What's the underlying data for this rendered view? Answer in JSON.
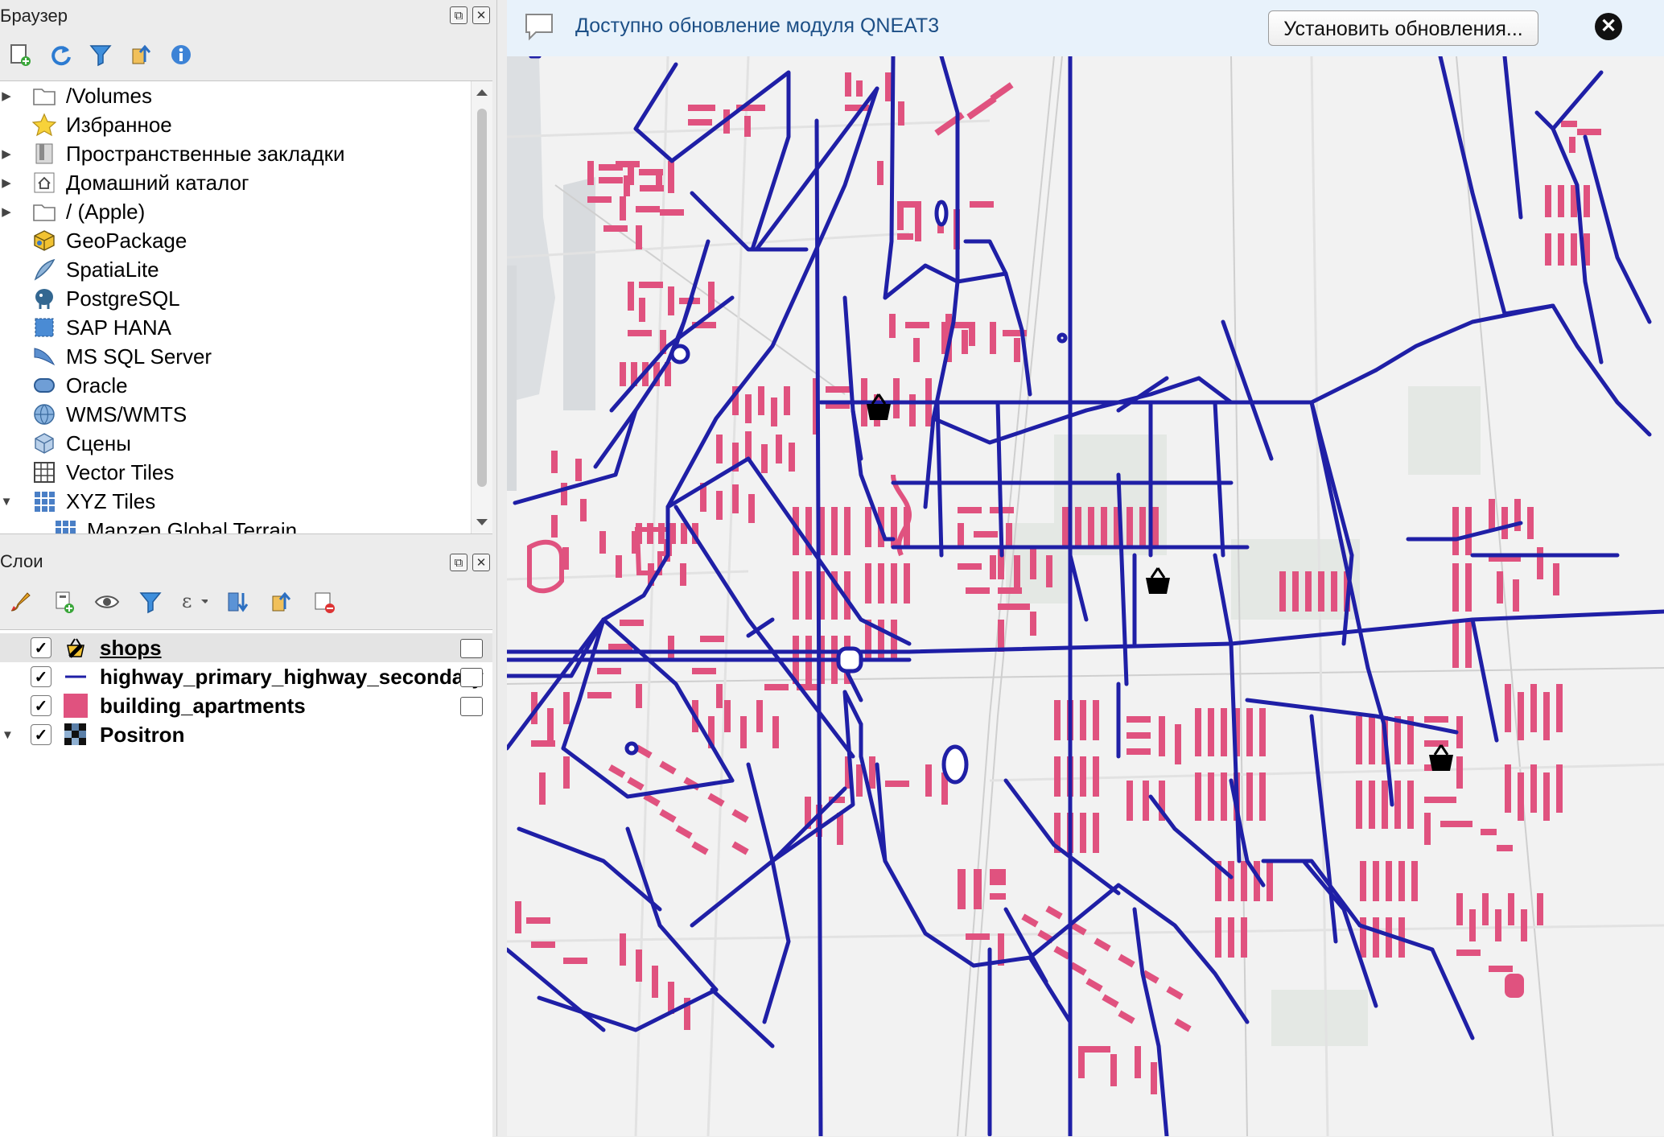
{
  "browser": {
    "title": "Браузер",
    "items": [
      {
        "label": "/Volumes",
        "icon": "folder-icon",
        "arrow": "▶"
      },
      {
        "label": "Избранное",
        "icon": "star-icon",
        "arrow": ""
      },
      {
        "label": "Пространственные закладки",
        "icon": "bookmark-icon",
        "arrow": "▶"
      },
      {
        "label": "Домашний каталог",
        "icon": "home-icon",
        "arrow": "▶"
      },
      {
        "label": "/ (Apple)",
        "icon": "folder-icon",
        "arrow": "▶"
      },
      {
        "label": "GeoPackage",
        "icon": "geopackage-icon",
        "arrow": ""
      },
      {
        "label": "SpatiaLite",
        "icon": "spatialite-icon",
        "arrow": ""
      },
      {
        "label": "PostgreSQL",
        "icon": "postgresql-icon",
        "arrow": ""
      },
      {
        "label": "SAP HANA",
        "icon": "sap-hana-icon",
        "arrow": ""
      },
      {
        "label": "MS SQL Server",
        "icon": "mssql-icon",
        "arrow": ""
      },
      {
        "label": "Oracle",
        "icon": "oracle-icon",
        "arrow": ""
      },
      {
        "label": "WMS/WMTS",
        "icon": "wms-icon",
        "arrow": ""
      },
      {
        "label": "Сцены",
        "icon": "scenes-icon",
        "arrow": ""
      },
      {
        "label": "Vector Tiles",
        "icon": "vector-tiles-icon",
        "arrow": ""
      },
      {
        "label": "XYZ Tiles",
        "icon": "xyz-tiles-icon",
        "arrow": "▼"
      },
      {
        "label": "Mapzen Global Terrain",
        "icon": "xyz-tiles-icon",
        "arrow": ""
      }
    ]
  },
  "layers": {
    "title": "Слои",
    "items": [
      {
        "label": "shops",
        "symbol": "shop-basket-icon",
        "checked": "✓"
      },
      {
        "label": "highway_primary_highway_secondary",
        "symbol": "line-symbol-icon",
        "checked": "✓"
      },
      {
        "label": "building_apartments",
        "symbol": "polygon-symbol-icon",
        "checked": "✓"
      },
      {
        "label": "Positron",
        "symbol": "raster-icon",
        "checked": "✓",
        "arrow": "▼"
      }
    ]
  },
  "panel_controls": {
    "float": "⧉",
    "close": "✕"
  },
  "banner": {
    "message": "Доступно обновление модуля QNEAT3",
    "button": "Установить обновления...",
    "close": "✕"
  },
  "colors": {
    "road": "#1f1fa6",
    "building": "#e0527f",
    "banner_bg": "#e8f2fb",
    "banner_text": "#1c4f86"
  }
}
